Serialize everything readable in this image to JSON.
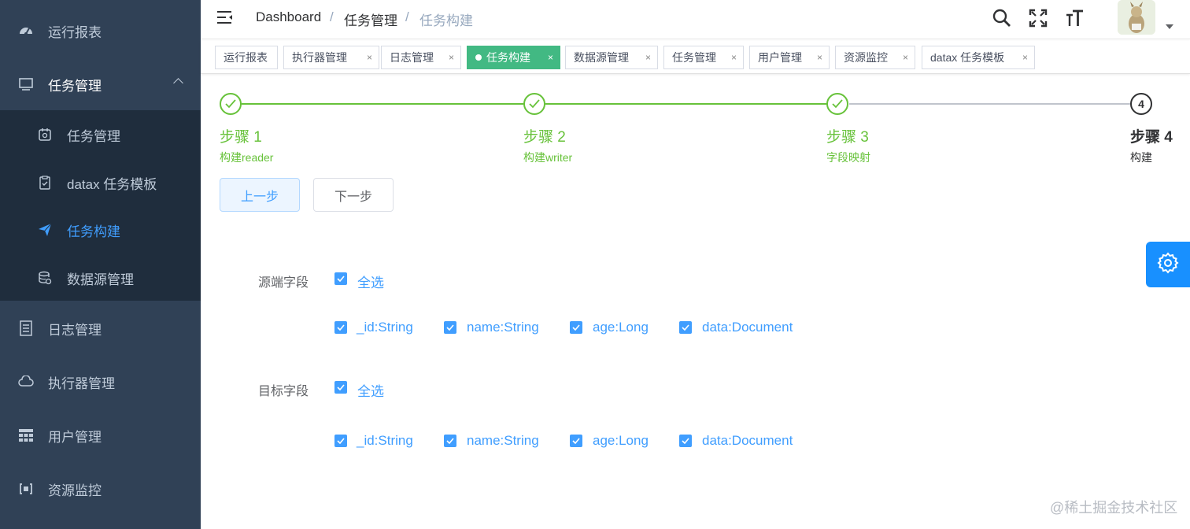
{
  "sidebar": {
    "items": [
      {
        "label": "运行报表",
        "icon": "dashboard-icon"
      },
      {
        "label": "任务管理",
        "icon": "monitor-icon"
      },
      {
        "label": "日志管理",
        "icon": "document-icon"
      },
      {
        "label": "执行器管理",
        "icon": "cloud-icon"
      },
      {
        "label": "用户管理",
        "icon": "table-icon"
      },
      {
        "label": "资源监控",
        "icon": "resource-icon"
      }
    ],
    "submenu": [
      {
        "label": "任务管理",
        "icon": "calendar-icon"
      },
      {
        "label": "datax 任务模板",
        "icon": "clipboard-icon"
      },
      {
        "label": "任务构建",
        "icon": "paper-plane-icon",
        "active": true
      },
      {
        "label": "数据源管理",
        "icon": "database-icon"
      }
    ]
  },
  "navbar": {
    "breadcrumb": [
      "Dashboard",
      "任务管理",
      "任务构建"
    ],
    "separator": "/"
  },
  "tags": [
    {
      "label": "运行报表",
      "closable": false
    },
    {
      "label": "执行器管理",
      "closable": true
    },
    {
      "label": "日志管理",
      "closable": true
    },
    {
      "label": "任务构建",
      "closable": true,
      "active": true
    },
    {
      "label": "数据源管理",
      "closable": true
    },
    {
      "label": "任务管理",
      "closable": true
    },
    {
      "label": "用户管理",
      "closable": true
    },
    {
      "label": "资源监控",
      "closable": true
    },
    {
      "label": "datax 任务模板",
      "closable": true
    }
  ],
  "close_glyph": "×",
  "steps": [
    {
      "title": "步骤 1",
      "desc": "构建reader",
      "status": "finished"
    },
    {
      "title": "步骤 2",
      "desc": "构建writer",
      "status": "finished"
    },
    {
      "title": "步骤 3",
      "desc": "字段映射",
      "status": "finished"
    },
    {
      "title": "步骤 4",
      "desc": "构建",
      "status": "current",
      "number": "4"
    }
  ],
  "buttons": {
    "prev": "上一步",
    "next": "下一步"
  },
  "source": {
    "label": "源端字段",
    "select_all": "全选",
    "fields": [
      "_id:String",
      "name:String",
      "age:Long",
      "data:Document"
    ]
  },
  "target": {
    "label": "目标字段",
    "select_all": "全选",
    "fields": [
      "_id:String",
      "name:String",
      "age:Long",
      "data:Document"
    ]
  },
  "watermark": "@稀土掘金技术社区",
  "colors": {
    "sidebar_bg": "#304156",
    "submenu_bg": "#1f2d3d",
    "primary": "#409eff",
    "success": "#67c23a",
    "tag_active": "#42b983"
  }
}
